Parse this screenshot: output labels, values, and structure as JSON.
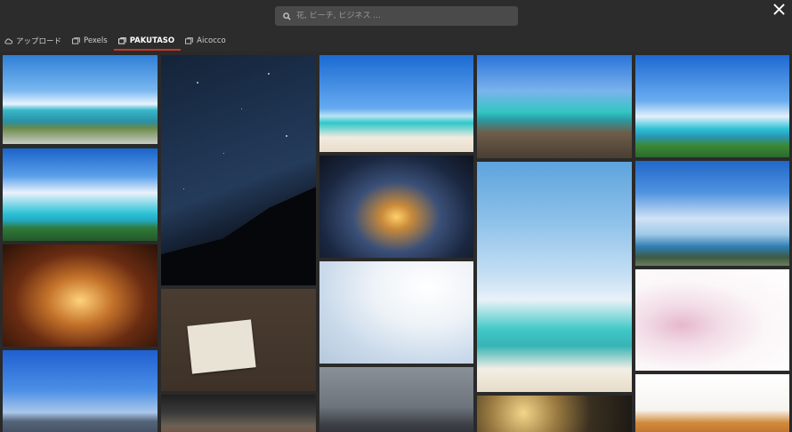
{
  "search": {
    "placeholder": "花, ビーチ, ビジネス ..."
  },
  "tabs": [
    {
      "label": "アップロード",
      "icon": "cloud-upload-icon",
      "active": false
    },
    {
      "label": "Pexels",
      "icon": "gallery-icon",
      "active": false
    },
    {
      "label": "PAKUTASO",
      "icon": "gallery-icon",
      "active": true
    },
    {
      "label": "Aicocco",
      "icon": "gallery-icon",
      "active": false
    }
  ],
  "colors": {
    "active_tab_underline": "#c0392b",
    "background": "#2c2c2c",
    "search_bg": "#4a4a4a"
  },
  "grid": {
    "columns": [
      [
        "beach-with-pier-photo",
        "tropical-island-coast-photo",
        "wine-glasses-bar-photo",
        "city-skyline-photo"
      ],
      [
        "milky-way-night-photo",
        "hand-holding-envelope-photo",
        "lizard-photo"
      ],
      [
        "white-sand-beach-photo",
        "sunset-over-sea-photo",
        "soft-light-bokeh-photo",
        "factory-chimneys-photo"
      ],
      [
        "rocky-coast-photo",
        "shallow-beach-sky-photo",
        "golden-bokeh-photo"
      ],
      [
        "tropical-island-photo",
        "clouds-over-ocean-photo",
        "cherry-blossom-photo",
        "croissant-photo"
      ]
    ]
  }
}
